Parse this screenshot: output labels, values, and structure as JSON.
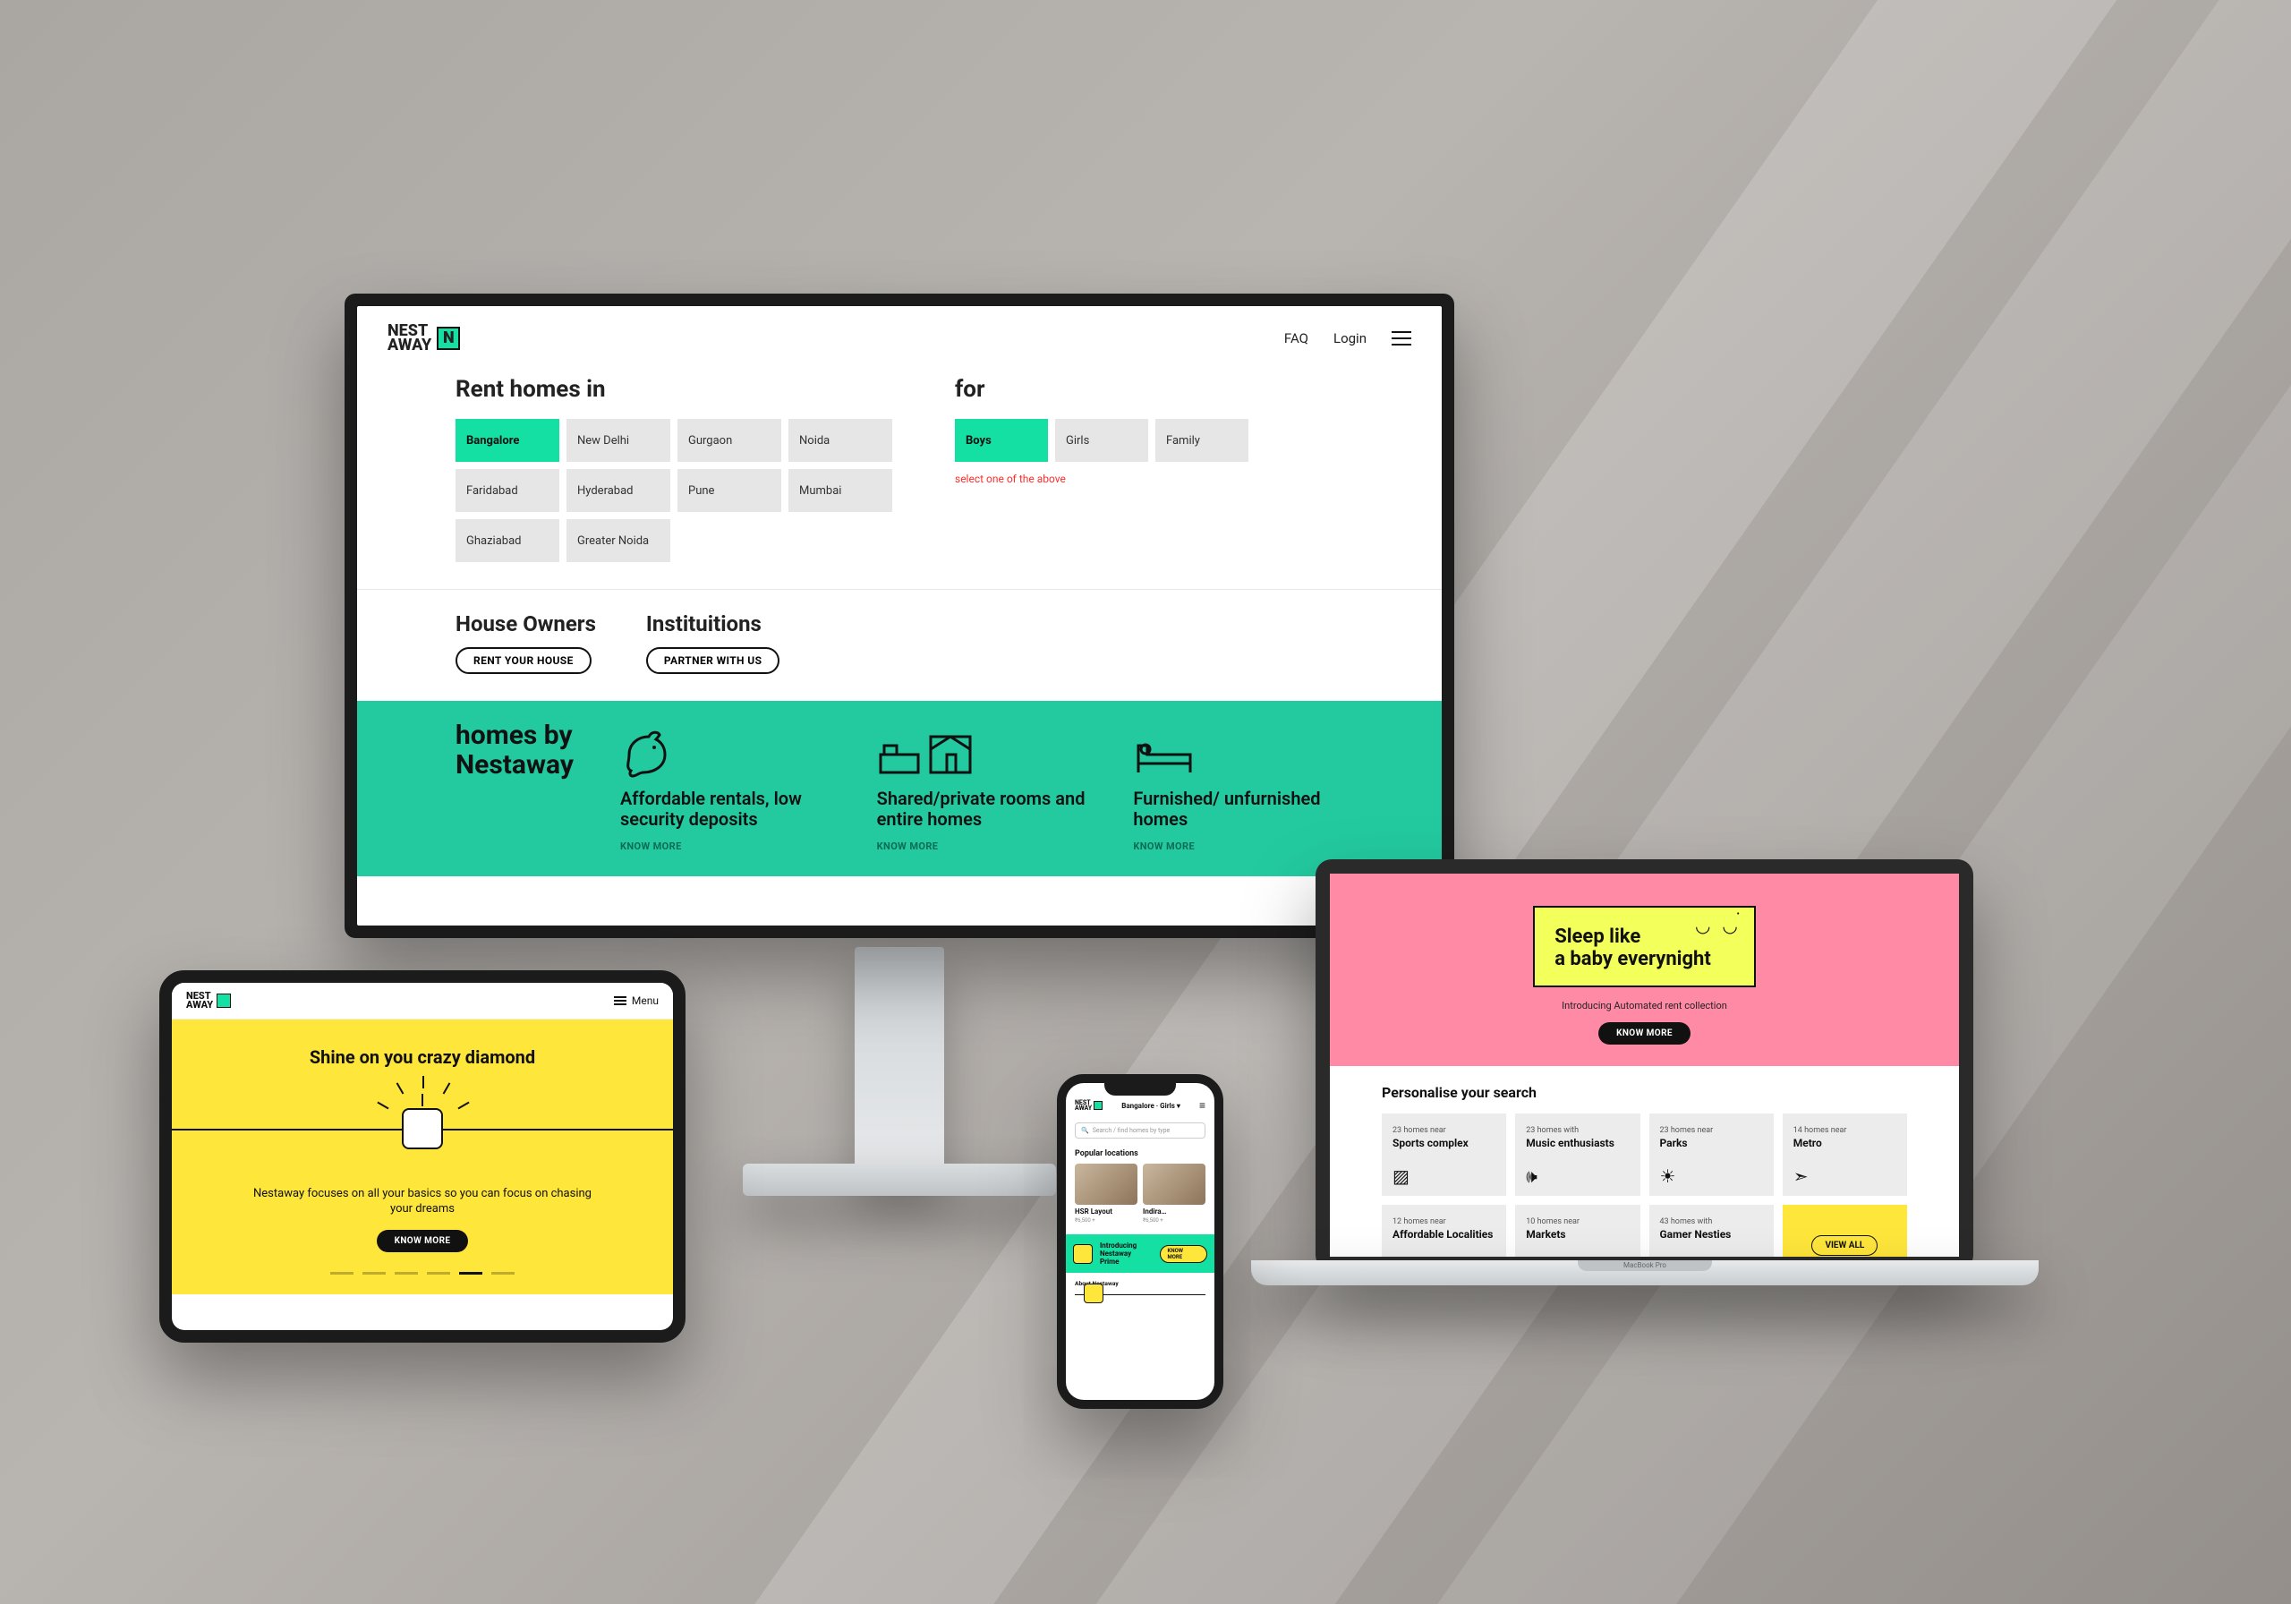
{
  "brand": {
    "line1": "NEST",
    "line2": "AWAY",
    "mark": "N"
  },
  "monitor": {
    "nav": {
      "faq": "FAQ",
      "login": "Login"
    },
    "rent_heading": "Rent homes in",
    "for_heading": "for",
    "cities": [
      "Bangalore",
      "New Delhi",
      "Gurgaon",
      "Noida",
      "Faridabad",
      "Hyderabad",
      "Pune",
      "Mumbai",
      "Ghaziabad",
      "Greater Noida"
    ],
    "city_active_index": 0,
    "for": [
      "Boys",
      "Girls",
      "Family"
    ],
    "for_active_index": 0,
    "hint": "select one of the above",
    "owners": {
      "h": "House Owners",
      "btn": "RENT YOUR HOUSE"
    },
    "inst": {
      "h": "Instituitions",
      "btn": "PARTNER WITH US"
    },
    "green_lead_l1": "homes by",
    "green_lead_l2": "Nestaway",
    "features": [
      {
        "title": "Affordable rentals, low security deposits",
        "cta": "KNOW MORE"
      },
      {
        "title": "Shared/private rooms and entire homes",
        "cta": "KNOW MORE"
      },
      {
        "title": "Furnished/ unfurnished homes",
        "cta": "KNOW MORE"
      }
    ]
  },
  "laptop": {
    "hero_l1": "Sleep like",
    "hero_l2": "a baby everynight",
    "sub": "Introducing Automated rent collection",
    "cta": "KNOW MORE",
    "personalise": "Personalise your search",
    "cards": [
      {
        "sub": "23 homes near",
        "title": "Sports complex",
        "icon": "image"
      },
      {
        "sub": "23 homes with",
        "title": "Music enthusiasts",
        "icon": "speaker"
      },
      {
        "sub": "23 homes near",
        "title": "Parks",
        "icon": "sun"
      },
      {
        "sub": "14 homes near",
        "title": "Metro",
        "icon": "nav"
      },
      {
        "sub": "12 homes near",
        "title": "Affordable Localities",
        "icon": "tag"
      },
      {
        "sub": "10 homes near",
        "title": "Markets",
        "icon": "cart"
      },
      {
        "sub": "43 homes with",
        "title": "Gamer Nesties",
        "icon": "game"
      }
    ],
    "viewall": "VIEW ALL"
  },
  "tablet": {
    "menu": "Menu",
    "hero": "Shine on you crazy diamond",
    "copy": "Nestaway focuses on all your basics so you can focus on chasing  your dreams",
    "cta": "KNOW MORE",
    "dot_active_index": 4,
    "dot_count": 6
  },
  "phone": {
    "breadcrumb": "Bangalore · Girls",
    "search_placeholder": "Search / find homes by type",
    "popular": "Popular locations",
    "locs": [
      {
        "name": "HSR Layout",
        "sub": "₹6,500 +"
      },
      {
        "name": "Indira…",
        "sub": "₹6,500 +"
      }
    ],
    "banner": {
      "l1": "Introducing",
      "l2": "Nestaway Prime",
      "btn": "KNOW MORE"
    },
    "about": "About Nestaway"
  },
  "laptop_base_label": "MacBook Pro"
}
